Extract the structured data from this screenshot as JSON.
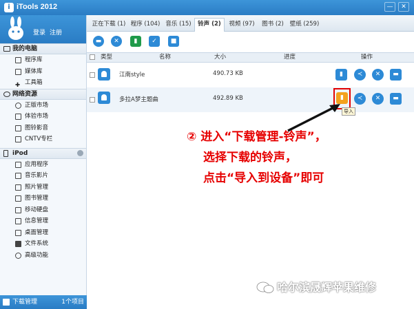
{
  "window": {
    "title": "iTools 2012",
    "min": "—",
    "close": "✕"
  },
  "account": {
    "login": "登录",
    "register": "注册"
  },
  "sidebar": {
    "groups": [
      {
        "label": "我的电脑",
        "items": [
          "程序库",
          "媒体库",
          "工具箱"
        ]
      },
      {
        "label": "网络资源",
        "items": [
          "正版市场",
          "体验市场",
          "图铃影音",
          "CNTV专栏"
        ]
      },
      {
        "label": "iPod",
        "items": [
          "应用程序",
          "音乐影片",
          "照片管理",
          "图书管理",
          "移动硬盘",
          "信息管理",
          "桌面管理",
          "文件系统",
          "高级功能"
        ]
      }
    ],
    "download": {
      "label": "下载管理",
      "count": "1个项目"
    }
  },
  "tabs": [
    "正在下载 (1)",
    "程序 (104)",
    "音乐 (15)",
    "铃声 (2)",
    "视频 (97)",
    "图书 (2)",
    "壁纸 (259)"
  ],
  "active_tab": "铃声 (2)",
  "table": {
    "headers": {
      "type": "类型",
      "name": "名称",
      "size": "大小",
      "progress": "进度",
      "ops": "操作"
    },
    "rows": [
      {
        "name": "江南style",
        "size": "490.73 KB"
      },
      {
        "name": "多拉A梦主题曲",
        "size": "492.89 KB"
      }
    ]
  },
  "tooltip": "导入",
  "annotation": {
    "line1": "② 进入“下载管理-铃声”，",
    "line2": "选择下载的铃声，",
    "line3": "点击“导入到设备”即可"
  },
  "watermark": "哈尔滨晟辉苹果维修",
  "colors": {
    "accent": "#2d8ad6",
    "highlight": "#e30000",
    "import": "#f3a21d"
  }
}
